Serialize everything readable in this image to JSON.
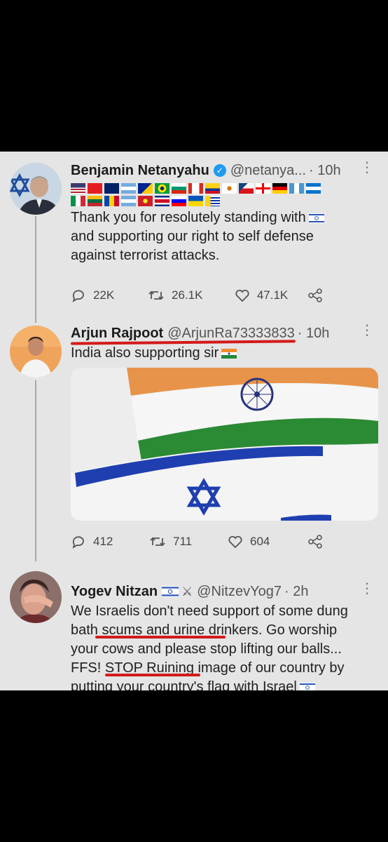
{
  "tweets": [
    {
      "name": "Benjamin Netanyahu",
      "handle": "@netanya...",
      "time": "· 10h",
      "verified": true,
      "lines": [
        "Thank you for resolutely standing with",
        "and supporting our right to self defense",
        "against terrorist attacks."
      ],
      "flags": [
        [
          "us",
          "al",
          "au",
          "ar",
          "ba",
          "br",
          "bg",
          "ca",
          "co",
          "cy",
          "cz",
          "ge",
          "de",
          "gt",
          "hn"
        ],
        [
          "it",
          "lt",
          "md",
          "ar",
          "mk",
          "cr",
          "si",
          "ua",
          "uy"
        ]
      ],
      "actions": {
        "replies": "22K",
        "retweets": "26.1K",
        "likes": "47.1K"
      }
    },
    {
      "name": "Arjun Rajpoot",
      "handle": "@ArjunRa73333833",
      "time": "· 10h",
      "lines": [
        "India also supporting sir"
      ],
      "actions": {
        "replies": "412",
        "retweets": "711",
        "likes": "604"
      }
    },
    {
      "name": "Yogev Nitzan",
      "handle": "@NitzevYog7",
      "time": "· 2h",
      "lines": [
        "We Israelis don't need support of some dung",
        "bath scums and urine drinkers. Go worship",
        "your cows and please stop lifting our balls...",
        "FFS! STOP Ruining image of our country by",
        "putting your country's flag with Israel"
      ]
    }
  ],
  "icons": {
    "reply": "reply-icon",
    "retweet": "retweet-icon",
    "like": "heart-icon",
    "share": "share-icon",
    "more": "more-icon"
  },
  "colors": {
    "background": "#e5e5e5",
    "frame": "#000000",
    "underline": "#d31a1a",
    "verified": "#1d9bf0"
  }
}
